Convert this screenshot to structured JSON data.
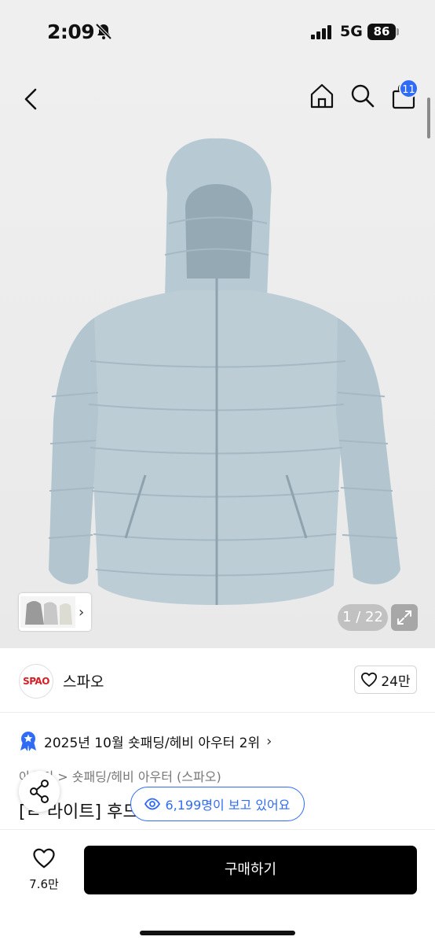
{
  "status_bar": {
    "time": "2:09",
    "network": "5G",
    "battery": "86"
  },
  "header": {
    "cart_count": "11"
  },
  "gallery": {
    "counter": "1 / 22"
  },
  "brand": {
    "logo_text": "SPAO",
    "name": "스파오",
    "likes": "24만"
  },
  "ranking": {
    "text": "2025년 10월 숏패딩/헤비 아우터 2위"
  },
  "breadcrumb": {
    "text": "아우터 > 숏패딩/헤비 아우터 (스파오)"
  },
  "product": {
    "title_partial": "[ㄹ 라이트] 후드"
  },
  "viewers": {
    "text": "6,199명이 보고 있어요"
  },
  "bottom": {
    "wish_count": "7.6만",
    "buy_label": "구매하기"
  },
  "colors": {
    "accent": "#2f6bf5",
    "brand_red": "#d51f27",
    "jacket": "#b9cbd5"
  }
}
